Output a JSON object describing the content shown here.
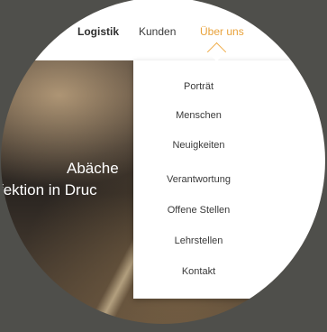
{
  "nav": {
    "items": [
      {
        "label": "Logistik"
      },
      {
        "label": "Kunden"
      },
      {
        "label": "Über uns"
      }
    ],
    "active": "Über uns",
    "accent_color": "#e8a23b"
  },
  "hero": {
    "title": "Abäche",
    "subtitle": "fektion in Druc"
  },
  "dropdown": {
    "items": [
      {
        "label": "Porträt"
      },
      {
        "label": "Menschen"
      },
      {
        "label": "Neuigkeiten"
      },
      {
        "label": "Verantwortung"
      },
      {
        "label": "Offene Stellen"
      },
      {
        "label": "Lehrstellen"
      },
      {
        "label": "Kontakt"
      }
    ]
  }
}
